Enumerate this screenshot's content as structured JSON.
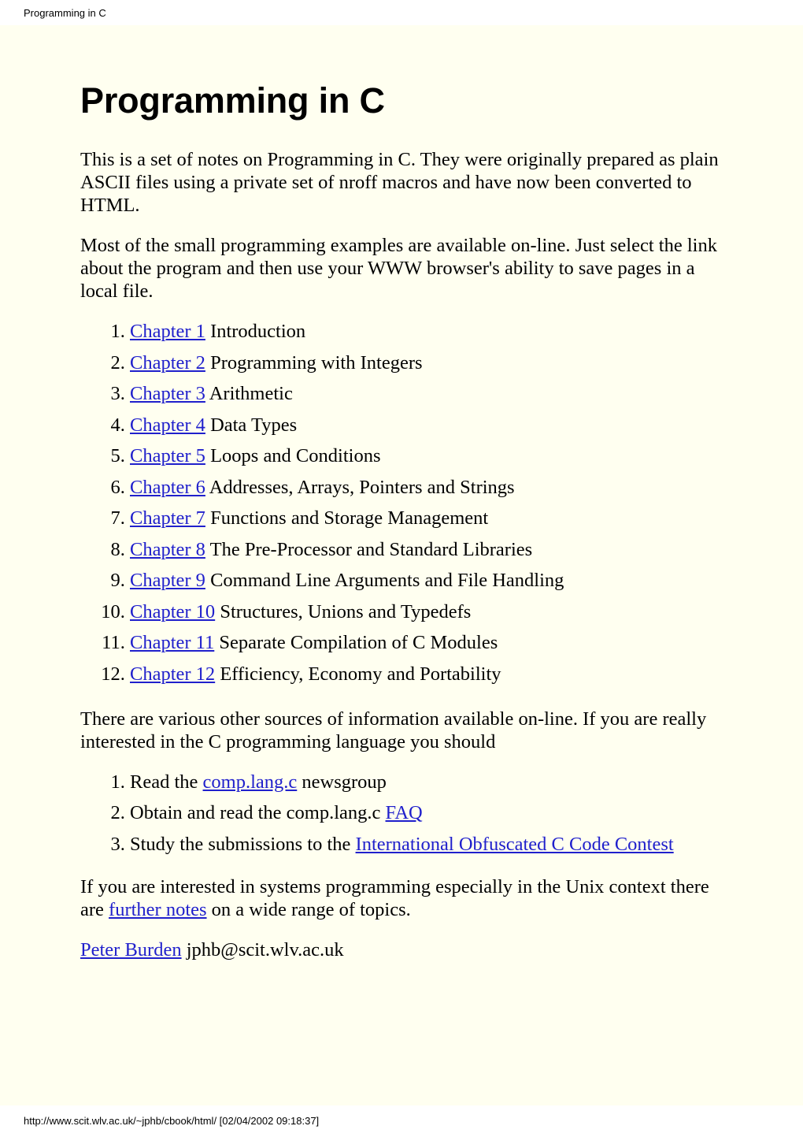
{
  "browser_header": {
    "document_title": "Programming in C"
  },
  "page": {
    "title": "Programming in C",
    "background_color": "#fffff0",
    "link_color": "#2020cc",
    "text_color": "#000000",
    "intro_paragraph": "This is a set of notes on Programming in C. They were originally prepared as plain ASCII files using a private set of nroff macros and have now been converted to HTML.",
    "examples_paragraph": "Most of the small programming examples are available on-line. Just select the link about the program and then use your WWW browser's ability to save pages in a local file.",
    "chapters": [
      {
        "link": "Chapter 1",
        "title": "Introduction"
      },
      {
        "link": "Chapter 2",
        "title": "Programming with Integers"
      },
      {
        "link": "Chapter 3",
        "title": "Arithmetic"
      },
      {
        "link": "Chapter 4",
        "title": "Data Types"
      },
      {
        "link": "Chapter 5",
        "title": "Loops and Conditions"
      },
      {
        "link": "Chapter 6",
        "title": "Addresses, Arrays, Pointers and Strings"
      },
      {
        "link": "Chapter 7",
        "title": "Functions and Storage Management"
      },
      {
        "link": "Chapter 8",
        "title": "The Pre-Processor and Standard Libraries"
      },
      {
        "link": "Chapter 9",
        "title": "Command Line Arguments and File Handling"
      },
      {
        "link": "Chapter 10",
        "title": "Structures, Unions and Typedefs"
      },
      {
        "link": "Chapter 11",
        "title": "Separate Compilation of C Modules"
      },
      {
        "link": "Chapter 12",
        "title": "Efficiency, Economy and Portability"
      }
    ],
    "other_sources_paragraph": "There are various other sources of information available on-line. If you are really interested in the C programming language you should",
    "sources": [
      {
        "before": "Read the ",
        "link": "comp.lang.c",
        "after": " newsgroup"
      },
      {
        "before": "Obtain and read the comp.lang.c ",
        "link": "FAQ",
        "after": ""
      },
      {
        "before": "Study the submissions to the ",
        "link": "International Obfuscated C Code Contest",
        "after": ""
      }
    ],
    "unix_paragraph": {
      "before": "If you are interested in systems programming especially in the Unix context there are ",
      "link": "further notes",
      "after": " on a wide range of topics."
    },
    "signature": {
      "link": "Peter Burden",
      "email": " jphb@scit.wlv.ac.uk"
    }
  },
  "footer": {
    "url_line": "http://www.scit.wlv.ac.uk/~jphb/cbook/html/ [02/04/2002 09:18:37]"
  }
}
